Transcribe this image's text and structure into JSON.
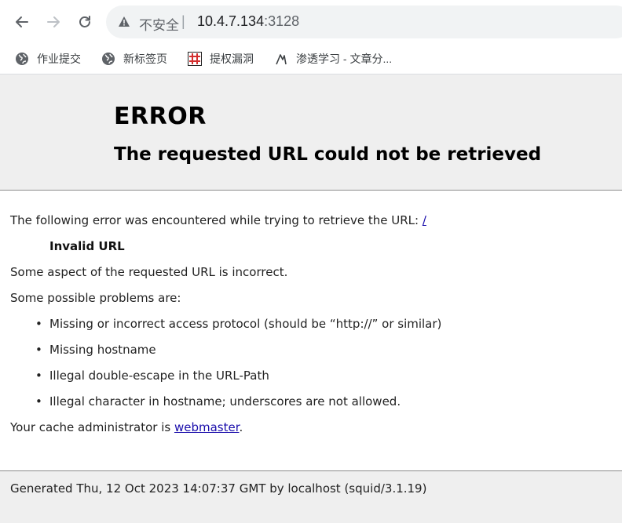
{
  "browser": {
    "address": {
      "insecure_label": "不安全",
      "separator": "|",
      "host": "10.4.7.134",
      "port": ":3128"
    },
    "bookmarks": [
      {
        "label": "作业提交",
        "icon": "globe-icon"
      },
      {
        "label": "新标签页",
        "icon": "globe-icon"
      },
      {
        "label": "提权漏洞",
        "icon": "hash-grid-icon"
      },
      {
        "label": "渗透学习 - 文章分...",
        "icon": "feather-icon"
      }
    ]
  },
  "page": {
    "title": "ERROR",
    "subtitle": "The requested URL could not be retrieved",
    "intro": "The following error was encountered while trying to retrieve the URL: ",
    "intro_link": "/",
    "error_name": "Invalid URL",
    "description": "Some aspect of the requested URL is incorrect.",
    "problems_heading": "Some possible problems are:",
    "problems": [
      "Missing or incorrect access protocol (should be “http://” or similar)",
      "Missing hostname",
      "Illegal double-escape in the URL-Path",
      "Illegal character in hostname; underscores are not allowed."
    ],
    "admin_prefix": "Your cache administrator is ",
    "admin_link": "webmaster",
    "admin_suffix": ".",
    "footer": "Generated Thu, 12 Oct 2023 14:07:37 GMT by localhost (squid/3.1.19)"
  },
  "colors": {
    "header_bg": "#efefef",
    "link": "#1a0dab"
  }
}
